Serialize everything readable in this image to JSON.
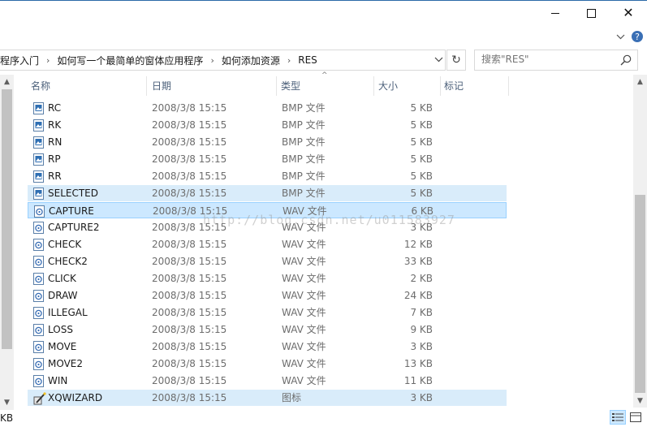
{
  "window": {
    "minimize_label": "minimize",
    "maximize_label": "maximize",
    "close_glyph": "✕"
  },
  "ribbon": {
    "expand_glyph": "⌵",
    "help_glyph": "?"
  },
  "address": {
    "breadcrumbs": [
      "程序入门",
      "如何写一个最简单的窗体应用程序",
      "如何添加资源",
      "RES"
    ],
    "separator": "›",
    "dropdown_glyph": "⌵",
    "refresh_glyph": "↻"
  },
  "search": {
    "placeholder": "搜索\"RES\""
  },
  "columns": {
    "name": "名称",
    "date": "日期",
    "type": "类型",
    "size": "大小",
    "tags": "标记",
    "sort_glyph": "^"
  },
  "files": [
    {
      "name": "RC",
      "date": "2008/3/8 15:15",
      "type": "BMP 文件",
      "size": "5 KB",
      "icon": "bitmap-file-icon"
    },
    {
      "name": "RK",
      "date": "2008/3/8 15:15",
      "type": "BMP 文件",
      "size": "5 KB",
      "icon": "bitmap-file-icon"
    },
    {
      "name": "RN",
      "date": "2008/3/8 15:15",
      "type": "BMP 文件",
      "size": "5 KB",
      "icon": "bitmap-file-icon"
    },
    {
      "name": "RP",
      "date": "2008/3/8 15:15",
      "type": "BMP 文件",
      "size": "5 KB",
      "icon": "bitmap-file-icon"
    },
    {
      "name": "RR",
      "date": "2008/3/8 15:15",
      "type": "BMP 文件",
      "size": "5 KB",
      "icon": "bitmap-file-icon"
    },
    {
      "name": "SELECTED",
      "date": "2008/3/8 15:15",
      "type": "BMP 文件",
      "size": "5 KB",
      "icon": "bitmap-file-icon"
    },
    {
      "name": "CAPTURE",
      "date": "2008/3/8 15:15",
      "type": "WAV 文件",
      "size": "6 KB",
      "icon": "audio-file-icon"
    },
    {
      "name": "CAPTURE2",
      "date": "2008/3/8 15:15",
      "type": "WAV 文件",
      "size": "3 KB",
      "icon": "audio-file-icon"
    },
    {
      "name": "CHECK",
      "date": "2008/3/8 15:15",
      "type": "WAV 文件",
      "size": "12 KB",
      "icon": "audio-file-icon"
    },
    {
      "name": "CHECK2",
      "date": "2008/3/8 15:15",
      "type": "WAV 文件",
      "size": "33 KB",
      "icon": "audio-file-icon"
    },
    {
      "name": "CLICK",
      "date": "2008/3/8 15:15",
      "type": "WAV 文件",
      "size": "2 KB",
      "icon": "audio-file-icon"
    },
    {
      "name": "DRAW",
      "date": "2008/3/8 15:15",
      "type": "WAV 文件",
      "size": "24 KB",
      "icon": "audio-file-icon"
    },
    {
      "name": "ILLEGAL",
      "date": "2008/3/8 15:15",
      "type": "WAV 文件",
      "size": "7 KB",
      "icon": "audio-file-icon"
    },
    {
      "name": "LOSS",
      "date": "2008/3/8 15:15",
      "type": "WAV 文件",
      "size": "9 KB",
      "icon": "audio-file-icon"
    },
    {
      "name": "MOVE",
      "date": "2008/3/8 15:15",
      "type": "WAV 文件",
      "size": "3 KB",
      "icon": "audio-file-icon"
    },
    {
      "name": "MOVE2",
      "date": "2008/3/8 15:15",
      "type": "WAV 文件",
      "size": "13 KB",
      "icon": "audio-file-icon"
    },
    {
      "name": "WIN",
      "date": "2008/3/8 15:15",
      "type": "WAV 文件",
      "size": "11 KB",
      "icon": "audio-file-icon"
    },
    {
      "name": "XQWIZARD",
      "date": "2008/3/8 15:15",
      "type": "图标",
      "size": "3 KB",
      "icon": "wizard-ico-file-icon"
    }
  ],
  "selection": {
    "selected_rows": [
      5,
      6,
      17
    ],
    "focused_row": 6
  },
  "watermark": "http://blog.csdn.net/u011583927",
  "status": {
    "left_text": "KB"
  },
  "colors": {
    "selection_bg": "#cce8ff",
    "selection_border": "#99d1ff",
    "header_text": "#4c607a",
    "accent": "#2b6aa8"
  }
}
